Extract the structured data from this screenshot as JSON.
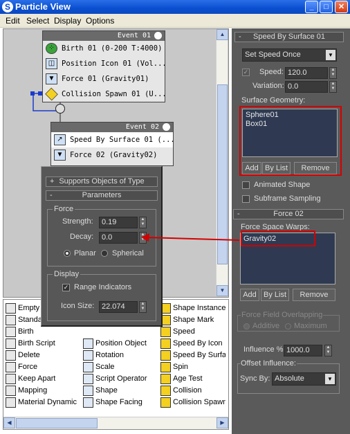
{
  "window": {
    "title": "Particle View",
    "app_icon": "3ds-max-icon"
  },
  "menu": [
    "Edit",
    "Select",
    "Display",
    "Options"
  ],
  "event01": {
    "title": "Event 01",
    "rows": [
      {
        "label": "Birth 01 (0-200 T:4000)",
        "icon": "birth-icon"
      },
      {
        "label": "Position Icon 01 (Vol...",
        "icon": "position-icon"
      },
      {
        "label": "Force 01 (Gravity01)",
        "icon": "force-icon"
      },
      {
        "label": "Collision Spawn 01 (U...",
        "icon": "collision-spawn-icon"
      }
    ]
  },
  "event02": {
    "title": "Event 02",
    "rows": [
      {
        "label": "Speed By Surface 01 (...",
        "icon": "speed-surface-icon"
      },
      {
        "label": "Force 02 (Gravity02)",
        "icon": "force-icon"
      }
    ]
  },
  "parameters_panel": {
    "supports_header": "Supports Objects of Type",
    "parameters_header": "Parameters",
    "force_group": "Force",
    "strength_label": "Strength:",
    "strength_value": "0.19",
    "decay_label": "Decay:",
    "decay_value": "0.0",
    "planar": "Planar",
    "spherical": "Spherical",
    "display_group": "Display",
    "range_indicators": "Range Indicators",
    "icon_size_label": "Icon Size:",
    "icon_size_value": "22.074"
  },
  "speed_by_surface": {
    "header": "Speed By Surface 01",
    "mode": "Set Speed Once",
    "speed_label": "Speed:",
    "speed_value": "120.0",
    "variation_label": "Variation:",
    "variation_value": "0.0",
    "surface_geometry": "Surface Geometry:",
    "list": [
      "Sphere01",
      "Box01"
    ],
    "add": "Add",
    "by_list": "By List",
    "remove": "Remove",
    "animated_shape": "Animated Shape",
    "subframe_sampling": "Subframe Sampling"
  },
  "force02": {
    "header": "Force 02",
    "force_space_warps": "Force Space Warps:",
    "list": [
      "Gravity02"
    ],
    "add": "Add",
    "by_list": "By List",
    "remove": "Remove",
    "overlapping": "Force Field Overlapping",
    "additive": "Additive",
    "maximum": "Maximum",
    "influence_label": "Influence %",
    "influence_value": "1000.0",
    "offset_influence": "Offset Influence:",
    "sync_by_label": "Sync By:",
    "sync_by_value": "Absolute"
  },
  "depot": {
    "col1": [
      "Empty",
      "Standard",
      "Birth",
      "Birth Script",
      "Delete",
      "Force",
      "Keep Apart",
      "Mapping",
      "Material Dynamic"
    ],
    "col2": [
      "Position Object",
      "Rotation",
      "Scale",
      "Script Operator",
      "Shape",
      "Shape Facing"
    ],
    "col3": [
      "Shape Instance",
      "Shape Mark",
      "Speed",
      "Speed By Icon",
      "Speed By Surface",
      "Spin",
      "Age Test",
      "Collision",
      "Collision Spawn"
    ]
  },
  "colors": {
    "highlight": "#d40000",
    "panel": "#5a5a5a",
    "graph": "#c8c8c8"
  }
}
